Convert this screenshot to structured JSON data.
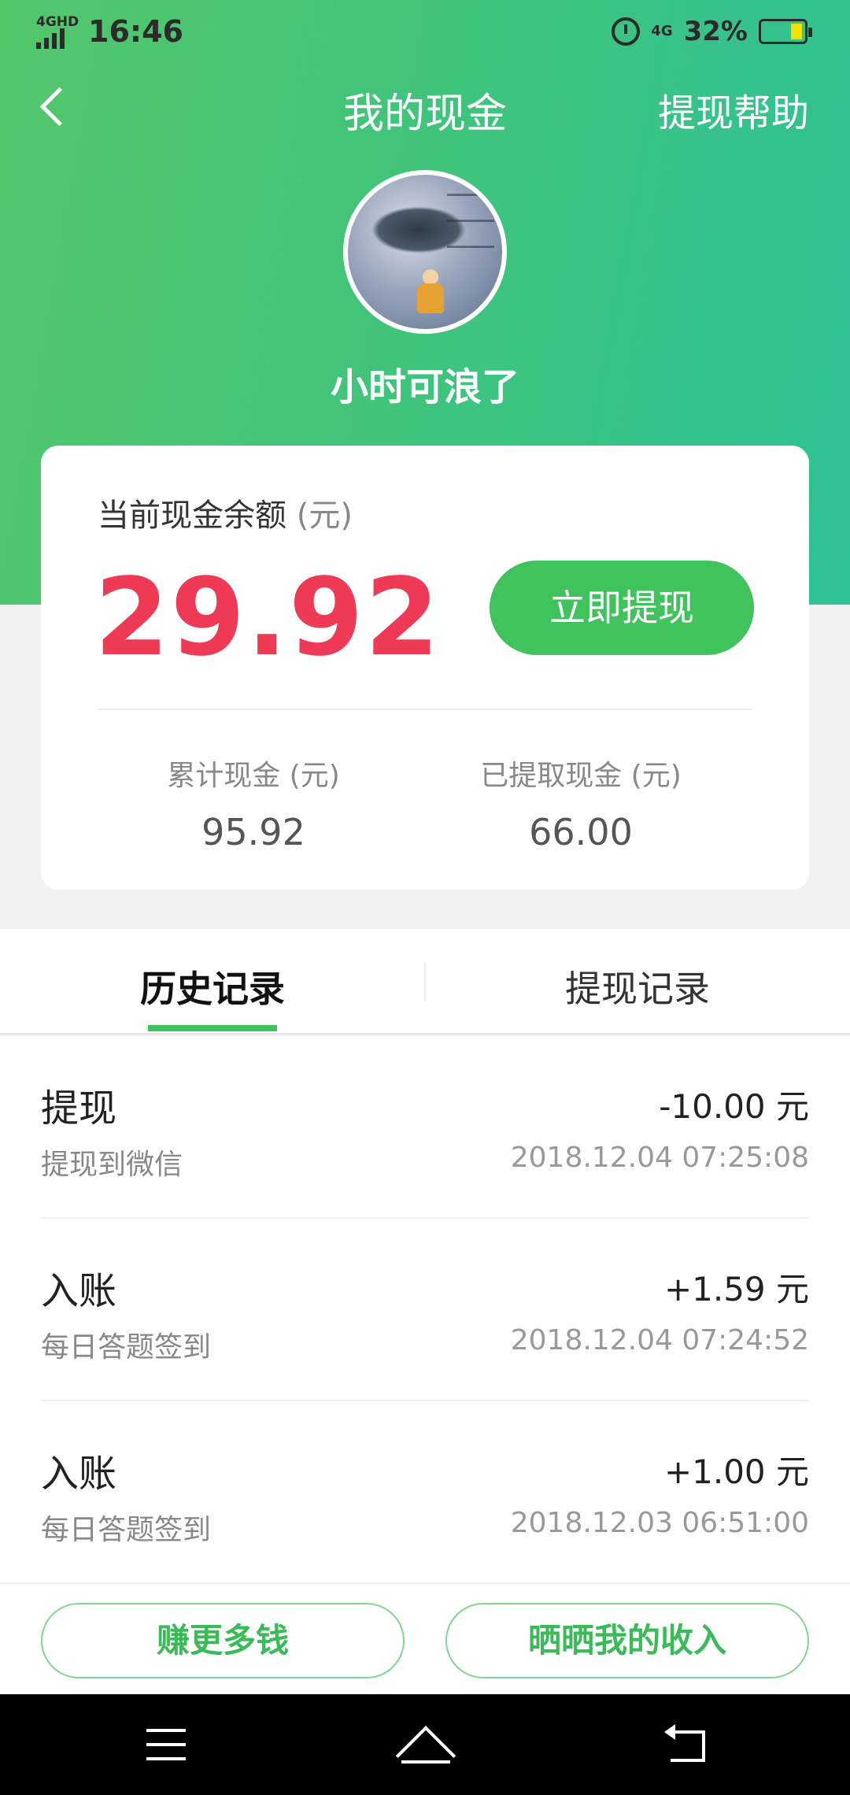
{
  "status_bar": {
    "network": "4GHD",
    "time": "16:46",
    "mobile_data": "4G",
    "battery_percent": "32%"
  },
  "header": {
    "title": "我的现金",
    "help_link": "提现帮助"
  },
  "profile": {
    "username": "小时可浪了"
  },
  "balance_card": {
    "label": "当前现金余额",
    "unit": "(元)",
    "balance": "29.92",
    "withdraw_button": "立即提现",
    "total_label": "累计现金 (元)",
    "total_value": "95.92",
    "withdrawn_label": "已提取现金 (元)",
    "withdrawn_value": "66.00"
  },
  "tabs": [
    {
      "label": "历史记录",
      "active": true
    },
    {
      "label": "提现记录",
      "active": false
    }
  ],
  "records": [
    {
      "type": "提现",
      "amount": "-10.00 元",
      "description": "提现到微信",
      "time": "2018.12.04 07:25:08"
    },
    {
      "type": "入账",
      "amount": "+1.59 元",
      "description": "每日答题签到",
      "time": "2018.12.04 07:24:52"
    },
    {
      "type": "入账",
      "amount": "+1.00 元",
      "description": "每日答题签到",
      "time": "2018.12.03 06:51:00"
    }
  ],
  "bottom_actions": {
    "earn_more": "赚更多钱",
    "share_income": "晒晒我的收入"
  },
  "colors": {
    "primary_green": "#40c25c",
    "balance_red": "#ef3a55"
  }
}
